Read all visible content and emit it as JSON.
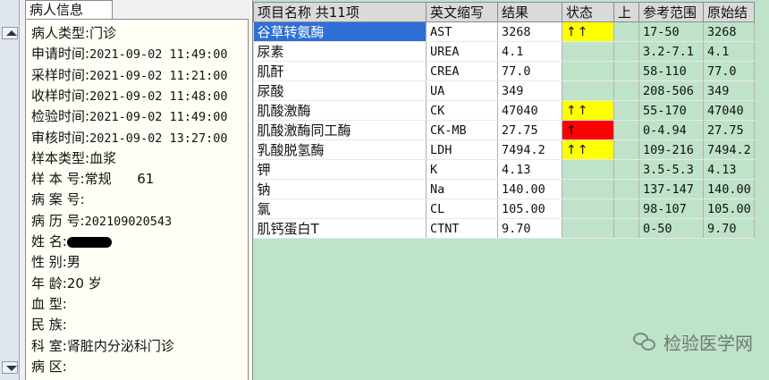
{
  "patient_tab": "病人信息",
  "patient_rows": [
    {
      "label": "病人类型:",
      "value": "门诊",
      "cjk": true
    },
    {
      "label": "申请时间:",
      "value": "2021-09-02 11:49:00",
      "cjk": false
    },
    {
      "label": "采样时间:",
      "value": "2021-09-02 11:21:00",
      "cjk": false
    },
    {
      "label": "收样时间:",
      "value": "2021-09-02 11:48:00",
      "cjk": false
    },
    {
      "label": "检验时间:",
      "value": "2021-09-02 11:49:00",
      "cjk": false
    },
    {
      "label": "审核时间:",
      "value": "2021-09-02 13:27:00",
      "cjk": false
    },
    {
      "label": "样本类型:",
      "value": "血浆",
      "cjk": true
    },
    {
      "label": "样 本 号:",
      "value": "常规      61",
      "cjk": true
    },
    {
      "label": "病 案 号:",
      "value": "",
      "cjk": true
    },
    {
      "label": "病 历 号:",
      "value": "202109020543",
      "cjk": false
    },
    {
      "label": "姓     名:",
      "value": "",
      "cjk": true,
      "redacted": true
    },
    {
      "label": "性     别:",
      "value": "男",
      "cjk": true
    },
    {
      "label": "年     龄:",
      "value": "20 岁",
      "cjk": true
    },
    {
      "label": "血     型:",
      "value": "",
      "cjk": true
    },
    {
      "label": "民     族:",
      "value": "",
      "cjk": true
    },
    {
      "label": "科     室:",
      "value": "肾脏内分泌科门诊",
      "cjk": true
    },
    {
      "label": "病     区:",
      "value": "",
      "cjk": true
    }
  ],
  "results": {
    "headers": {
      "name": "项目名称 共11项",
      "abbr": "英文缩写",
      "result": "结果",
      "status": "状态",
      "upper": "上",
      "ref": "参考范围",
      "orig": "原始结"
    },
    "rows": [
      {
        "name": "谷草转氨酶",
        "abbr": "AST",
        "result": "3268",
        "status": "↑↑",
        "flag": "yellow",
        "ref": "17-50",
        "orig": "3268",
        "selected": true
      },
      {
        "name": "尿素",
        "abbr": "UREA",
        "result": "4.1",
        "status": "",
        "flag": "",
        "ref": "3.2-7.1",
        "orig": "4.1"
      },
      {
        "name": "肌酐",
        "abbr": "CREA",
        "result": "77.0",
        "status": "",
        "flag": "",
        "ref": "58-110",
        "orig": "77.0"
      },
      {
        "name": "尿酸",
        "abbr": "UA",
        "result": "349",
        "status": "",
        "flag": "",
        "ref": "208-506",
        "orig": "349"
      },
      {
        "name": "肌酸激酶",
        "abbr": "CK",
        "result": "47040",
        "status": "↑↑",
        "flag": "yellow",
        "ref": "55-170",
        "orig": "47040"
      },
      {
        "name": "肌酸激酶同工酶",
        "abbr": "CK-MB",
        "result": "27.75",
        "status": "↑",
        "flag": "red",
        "ref": "0-4.94",
        "orig": "27.75"
      },
      {
        "name": "乳酸脱氢酶",
        "abbr": "LDH",
        "result": "7494.2",
        "status": "↑↑",
        "flag": "yellow",
        "ref": "109-216",
        "orig": "7494.2"
      },
      {
        "name": "钾",
        "abbr": "K",
        "result": "4.13",
        "status": "",
        "flag": "",
        "ref": "3.5-5.3",
        "orig": "4.13"
      },
      {
        "name": "钠",
        "abbr": "Na",
        "result": "140.00",
        "status": "",
        "flag": "",
        "ref": "137-147",
        "orig": "140.00"
      },
      {
        "name": "氯",
        "abbr": "CL",
        "result": "105.00",
        "status": "",
        "flag": "",
        "ref": "98-107",
        "orig": "105.00"
      },
      {
        "name": "肌钙蛋白T",
        "abbr": "CTNT",
        "result": "9.70",
        "status": "",
        "flag": "",
        "ref": "0-50",
        "orig": "9.70"
      }
    ]
  },
  "watermark": "检验医学网",
  "icons": {
    "watermark": "wechat-icon",
    "strip_up": "scroll-up-icon",
    "strip_down": "scroll-down-icon"
  }
}
